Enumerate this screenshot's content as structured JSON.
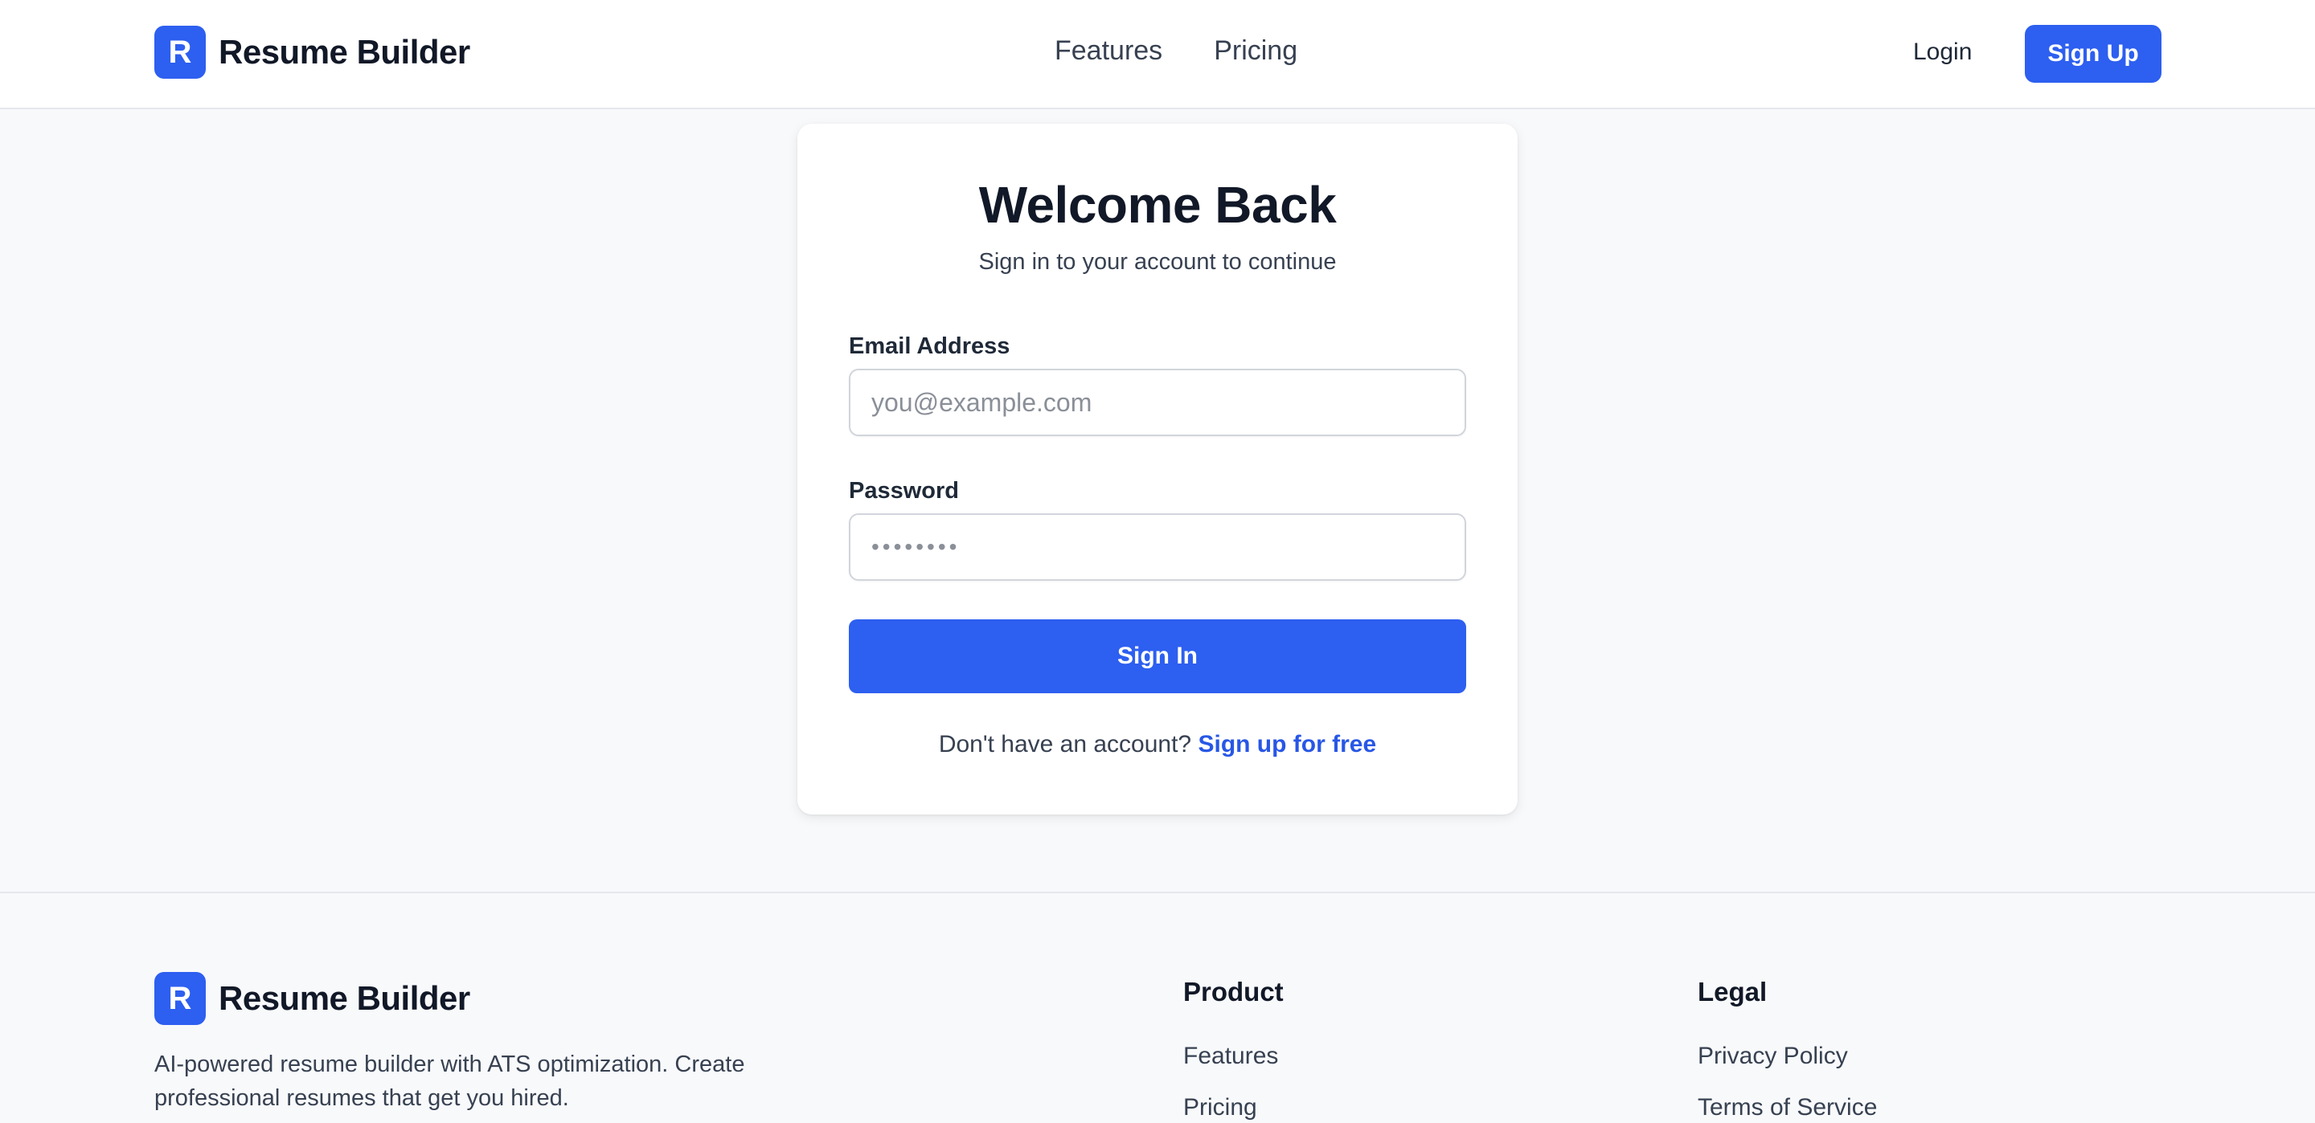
{
  "header": {
    "logo_letter": "R",
    "brand": "Resume Builder",
    "nav": [
      "Features",
      "Pricing"
    ],
    "login": "Login",
    "signup": "Sign Up"
  },
  "login_card": {
    "title": "Welcome Back",
    "subtitle": "Sign in to your account to continue",
    "email_label": "Email Address",
    "email_placeholder": "you@example.com",
    "password_label": "Password",
    "password_placeholder": "••••••••",
    "submit": "Sign In",
    "footer_text": "Don't have an account?",
    "footer_link": "Sign up for free"
  },
  "footer": {
    "logo_letter": "R",
    "brand": "Resume Builder",
    "description": "AI-powered resume builder with ATS optimization. Create professional resumes that get you hired.",
    "columns": [
      {
        "title": "Product",
        "links": [
          "Features",
          "Pricing"
        ]
      },
      {
        "title": "Legal",
        "links": [
          "Privacy Policy",
          "Terms of Service"
        ]
      }
    ]
  },
  "colors": {
    "accent": "#2d5ff0",
    "link": "#2857e6",
    "background": "#f8f9fb"
  },
  "icons": [
    "resume-builder-logo-icon"
  ]
}
